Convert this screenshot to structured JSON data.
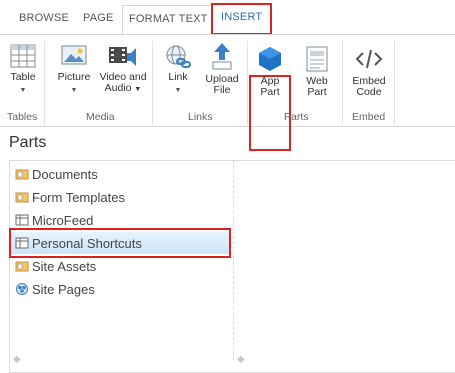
{
  "tabs": {
    "browse": "BROWSE",
    "page": "PAGE",
    "format_text": "FORMAT TEXT",
    "insert": "INSERT"
  },
  "ribbon": {
    "table": {
      "label": "Table"
    },
    "picture": {
      "label": "Picture"
    },
    "video_audio": {
      "label1": "Video and",
      "label2": "Audio"
    },
    "link": {
      "label": "Link"
    },
    "upload_file": {
      "label1": "Upload",
      "label2": "File"
    },
    "app_part": {
      "label1": "App",
      "label2": "Part"
    },
    "web_part": {
      "label1": "Web",
      "label2": "Part"
    },
    "embed_code": {
      "label1": "Embed",
      "label2": "Code"
    },
    "groups": {
      "tables": "Tables",
      "media": "Media",
      "links": "Links",
      "parts": "Parts",
      "embed": "Embed"
    }
  },
  "parts": {
    "title": "Parts",
    "items": [
      {
        "label": "Documents",
        "icon": "library-icon"
      },
      {
        "label": "Form Templates",
        "icon": "library-icon"
      },
      {
        "label": "MicroFeed",
        "icon": "list-icon"
      },
      {
        "label": "Personal Shortcuts",
        "icon": "list-icon"
      },
      {
        "label": "Site Assets",
        "icon": "library-icon"
      },
      {
        "label": "Site Pages",
        "icon": "wiki-icon"
      }
    ],
    "selected_index": 3
  },
  "colors": {
    "accent_blue": "#2a6bb8",
    "highlight_red": "#dd2222",
    "selection_bg": "#cce4f7"
  }
}
